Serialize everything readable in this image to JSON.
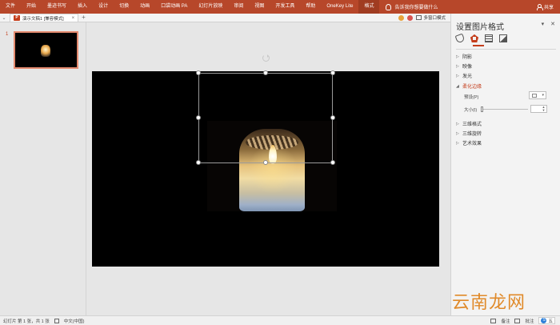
{
  "ribbon": {
    "tabs": [
      "文件",
      "开始",
      "墨迹书写",
      "插入",
      "设计",
      "切换",
      "动画",
      "口袋动画 PA",
      "幻灯片放映",
      "审阅",
      "视图",
      "开发工具",
      "帮助",
      "OneKey Lite",
      "格式"
    ],
    "active_tab": "格式",
    "tell_me": "告诉我你想要做什么",
    "share": "共享",
    "bg_color": "#b7472a"
  },
  "docbar": {
    "doc_name": "演示文稿1 [兼容模式]",
    "ppt_icon_letter": "P",
    "new_tab": "+",
    "multi_window": "多窗口模式"
  },
  "thumbnails": {
    "slide_number": "1"
  },
  "format_pane": {
    "title": "设置图片格式",
    "dropdown": "▾",
    "close": "✕",
    "sections": {
      "shadow": "阴影",
      "reflection": "映像",
      "glow": "发光",
      "soft_edges": "柔化边缘",
      "format_3d": "三维格式",
      "rotation_3d": "三维旋转",
      "artistic": "艺术效果"
    },
    "preset_label": "预设(P)",
    "size_label": "大小(I)"
  },
  "status": {
    "slide_info": "幻灯片 第 1 张，共 1 张",
    "language": "中文(中国)",
    "notes": "备注",
    "comments": "批注",
    "ime_text": "五"
  },
  "watermark": "云南龙网"
}
